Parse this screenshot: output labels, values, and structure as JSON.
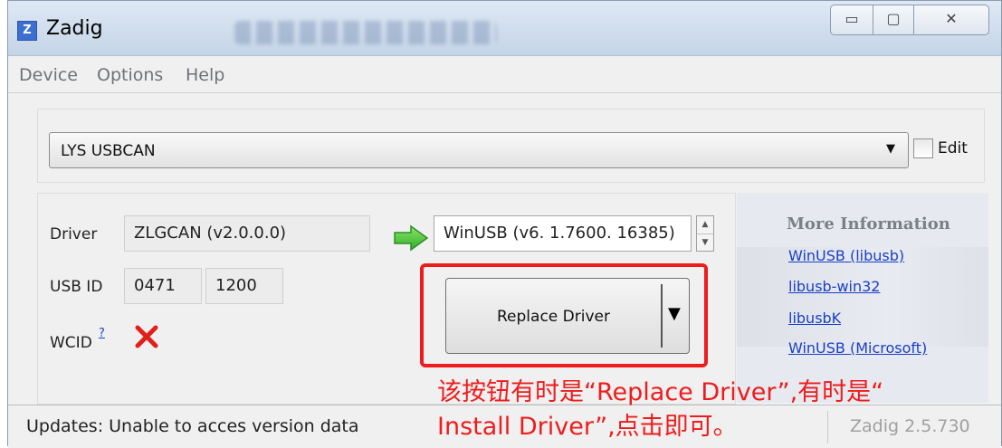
{
  "window": {
    "app_icon": "Z",
    "title": "Zadig",
    "controls": {
      "minimize": "minimize-icon",
      "maximize": "maximize-icon",
      "close": "close-icon"
    }
  },
  "menu": {
    "items": [
      "Device",
      "Options",
      "Help"
    ]
  },
  "device": {
    "selected": "LYS USBCAN",
    "edit_label": "Edit",
    "edit_checked": false
  },
  "driver": {
    "label": "Driver",
    "current": "ZLGCAN (v2.0.0.0)",
    "target": "WinUSB (v6. 1.7600. 16385)"
  },
  "usb_id": {
    "label": "USB ID",
    "vid": "0471",
    "pid": "1200"
  },
  "wcid": {
    "label": "WCID",
    "help_mark": "?",
    "status_icon": "red-x-icon"
  },
  "replace_button": {
    "label": "Replace Driver"
  },
  "more_info": {
    "title": "More Information",
    "links": [
      "WinUSB (libusb)",
      "libusb-win32",
      "libusbK",
      "WinUSB (Microsoft)"
    ]
  },
  "status": {
    "message": "Updates: Unable to acces version data",
    "version": "Zadig 2.5.730"
  },
  "annotation": {
    "line1": "该按钮有时是“Replace Driver”,有时是“",
    "line2": "Install Driver”,点击即可。",
    "color": "#ee1c1c"
  }
}
